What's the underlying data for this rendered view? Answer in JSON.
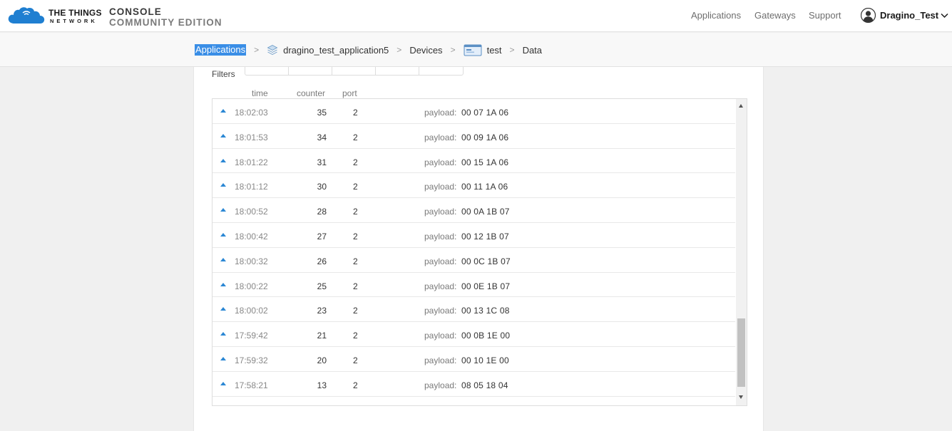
{
  "header": {
    "brand_line1": "THE THINGS",
    "brand_line2": "NETWORK",
    "product_line1": "CONSOLE",
    "product_line2": "COMMUNITY EDITION",
    "nav": {
      "applications": "Applications",
      "gateways": "Gateways",
      "support": "Support"
    },
    "user": "Dragino_Test"
  },
  "breadcrumb": {
    "applications": "Applications",
    "application": "dragino_test_application5",
    "devices": "Devices",
    "device": "test",
    "data": "Data"
  },
  "filters": {
    "label": "Filters"
  },
  "table": {
    "columns": {
      "time": "time",
      "counter": "counter",
      "port": "port"
    },
    "payload_label": "payload:",
    "rows": [
      {
        "time": "18:02:03",
        "counter": "35",
        "port": "2",
        "payload": "00 07 1A 06"
      },
      {
        "time": "18:01:53",
        "counter": "34",
        "port": "2",
        "payload": "00 09 1A 06"
      },
      {
        "time": "18:01:22",
        "counter": "31",
        "port": "2",
        "payload": "00 15 1A 06"
      },
      {
        "time": "18:01:12",
        "counter": "30",
        "port": "2",
        "payload": "00 11 1A 06"
      },
      {
        "time": "18:00:52",
        "counter": "28",
        "port": "2",
        "payload": "00 0A 1B 07"
      },
      {
        "time": "18:00:42",
        "counter": "27",
        "port": "2",
        "payload": "00 12 1B 07"
      },
      {
        "time": "18:00:32",
        "counter": "26",
        "port": "2",
        "payload": "00 0C 1B 07"
      },
      {
        "time": "18:00:22",
        "counter": "25",
        "port": "2",
        "payload": "00 0E 1B 07"
      },
      {
        "time": "18:00:02",
        "counter": "23",
        "port": "2",
        "payload": "00 13 1C 08"
      },
      {
        "time": "17:59:42",
        "counter": "21",
        "port": "2",
        "payload": "00 0B 1E 00"
      },
      {
        "time": "17:59:32",
        "counter": "20",
        "port": "2",
        "payload": "00 10 1E 00"
      },
      {
        "time": "17:58:21",
        "counter": "13",
        "port": "2",
        "payload": "08 05 18 04"
      }
    ]
  },
  "colors": {
    "accent": "#2b87d4",
    "selection": "#3a8ee6",
    "logo": "#1f7fd1"
  },
  "icons": {
    "logo": "cloud-logo-icon",
    "user": "user-avatar-icon",
    "dropdown": "chevron-down-icon",
    "application": "layers-icon",
    "device": "device-icon",
    "uplink": "triangle-up-icon"
  }
}
